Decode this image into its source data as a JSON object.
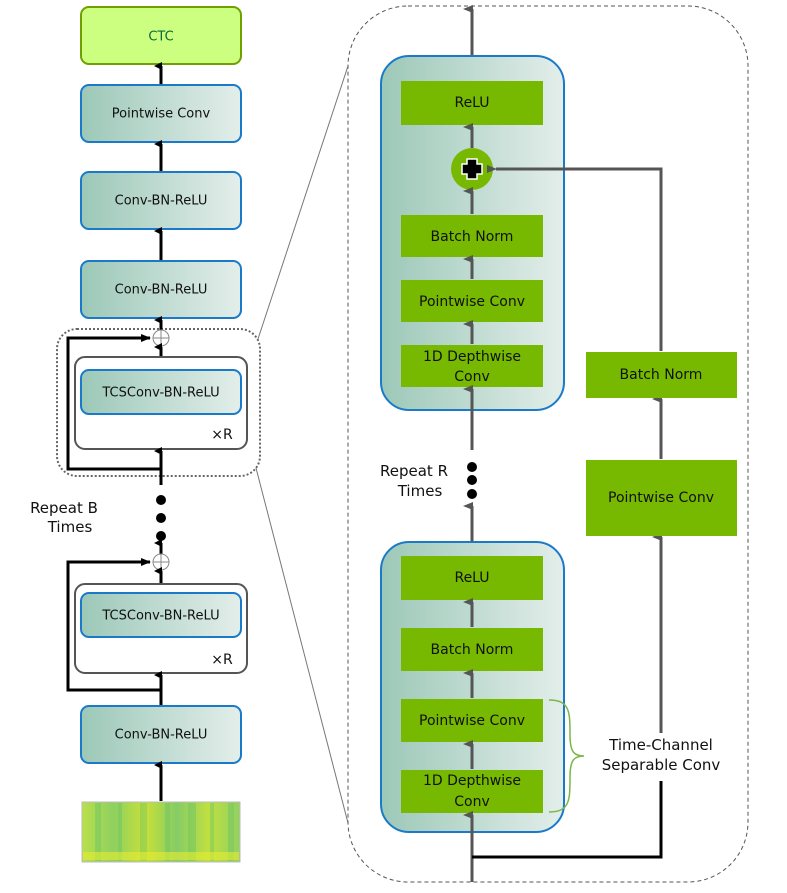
{
  "colors": {
    "nvidia_green": "#76b900",
    "ctc_fill": "#ccff80",
    "ctc_border": "#6fa000",
    "block_border": "#1a7ac9",
    "block_grad_start": "#9cc8b8",
    "block_grad_end": "#e0ece8",
    "arrow_dark": "#000000",
    "arrow_gray": "#555555",
    "brace": "#7ab648"
  },
  "left": {
    "ctc": "CTC",
    "pointwise_conv": "Pointwise Conv",
    "conv_bn_relu_top1": "Conv-BN-ReLU",
    "conv_bn_relu_top2": "Conv-BN-ReLU",
    "tcs_block_1": "TCSConv-BN-ReLU",
    "tcs_block_1_repeat": "×R",
    "repeat_b_line1": "Repeat B",
    "repeat_b_line2": "Times",
    "tcs_block_2": "TCSConv-BN-ReLU",
    "tcs_block_2_repeat": "×R",
    "conv_bn_relu_bottom": "Conv-BN-ReLU",
    "input_image": "spectrogram"
  },
  "right": {
    "upper_block": {
      "relu": "ReLU",
      "batch_norm": "Batch Norm",
      "pointwise_conv": "Pointwise Conv",
      "depthwise_line1": "1D Depthwise",
      "depthwise_line2": "Conv"
    },
    "repeat_r_line1": "Repeat R",
    "repeat_r_line2": "Times",
    "lower_block": {
      "relu": "ReLU",
      "batch_norm": "Batch Norm",
      "pointwise_conv": "Pointwise Conv",
      "depthwise_line1": "1D Depthwise",
      "depthwise_line2": "Conv"
    },
    "residual": {
      "batch_norm": "Batch Norm",
      "pointwise_conv": "Pointwise Conv"
    },
    "tcs_label_line1": "Time-Channel",
    "tcs_label_line2": "Separable Conv"
  }
}
